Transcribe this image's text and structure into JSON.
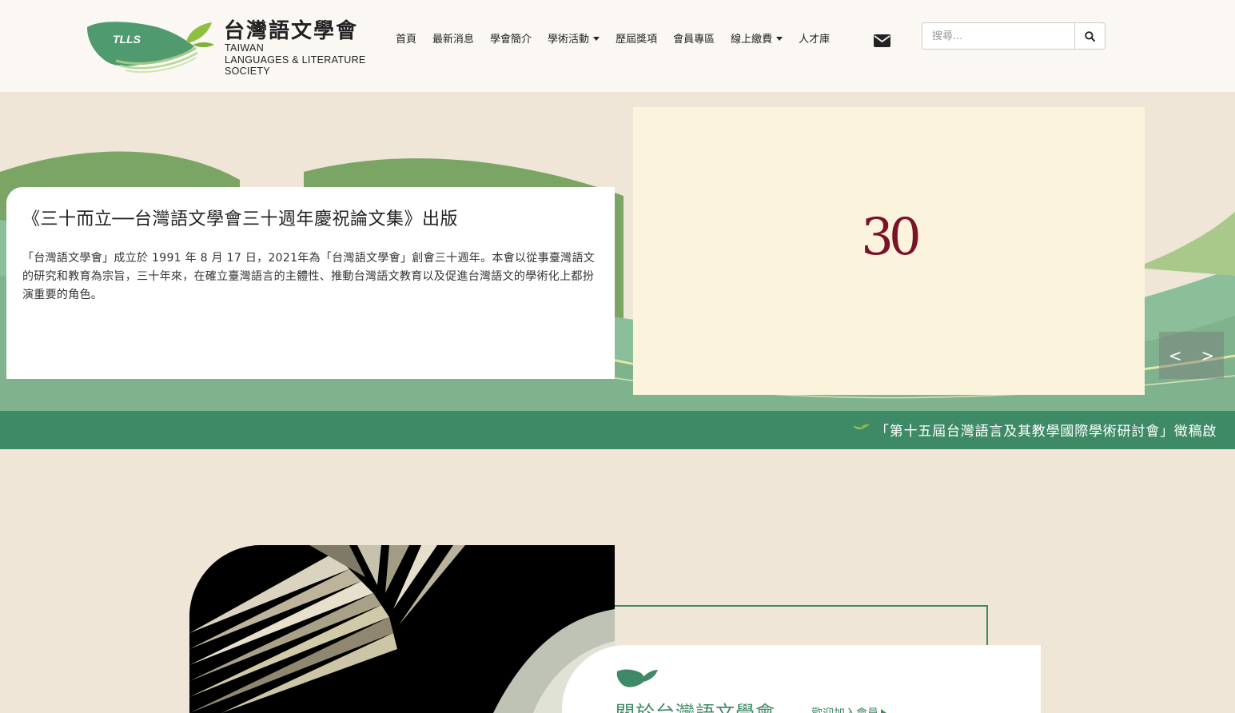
{
  "logo": {
    "badge": "TLLS",
    "title": "台灣語文學會",
    "sub1": "TAIWAN",
    "sub2": "LANGUAGES & LITERATURE",
    "sub3": "SOCIETY"
  },
  "nav": {
    "items": [
      {
        "label": "首頁",
        "dropdown": false
      },
      {
        "label": "最新消息",
        "dropdown": false
      },
      {
        "label": "學會簡介",
        "dropdown": false
      },
      {
        "label": "學術活動",
        "dropdown": true
      },
      {
        "label": "歷屆獎項",
        "dropdown": false
      },
      {
        "label": "會員專區",
        "dropdown": false
      },
      {
        "label": "線上繳費",
        "dropdown": true
      },
      {
        "label": "人才庫",
        "dropdown": false
      }
    ],
    "mail_icon": "envelope-icon"
  },
  "search": {
    "placeholder": "搜尋...",
    "button_icon": "search-icon"
  },
  "hero": {
    "title": "《三十而立──台灣語文學會三十週年慶祝論文集》出版",
    "body": "「台灣語文學會」成立於 1991 年 8 月 17 日，2021年為「台灣語文學會」創會三十週年。本會以從事臺灣語文的研究和教育為宗旨，三十年來，在確立臺灣語言的主體性、推動台灣語文教育以及促進台灣語文的學術化上都扮演重要的角色。",
    "image_text": "30",
    "prev": "<",
    "next": ">"
  },
  "marquee": {
    "text": "「第十五屆台灣語言及其教學國際學術研討會」徵稿啟"
  },
  "about": {
    "title": "關於台灣語文學會",
    "link": "歡迎加入會員"
  },
  "colors": {
    "brand_green": "#3f8a66",
    "header_bg": "#fbf8f4",
    "page_bg": "#efe6d8",
    "accent_red": "#7a1328"
  }
}
